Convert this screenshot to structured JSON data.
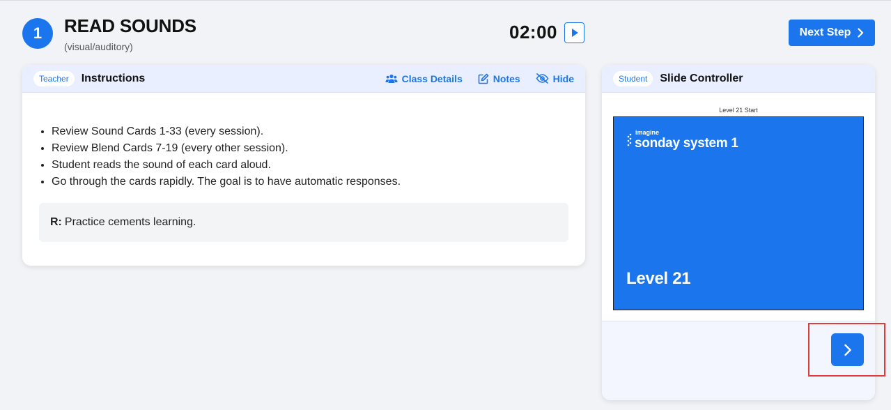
{
  "step": {
    "number": "1",
    "title": "READ SOUNDS",
    "subtitle": "(visual/auditory)"
  },
  "timer": {
    "time": "02:00",
    "play_icon": "play-icon"
  },
  "next_step": {
    "label": "Next Step",
    "icon": "chevron-right-icon"
  },
  "instructions_panel": {
    "badge": "Teacher",
    "title": "Instructions",
    "actions": [
      {
        "label": "Class Details",
        "icon": "users-icon"
      },
      {
        "label": "Notes",
        "icon": "edit-icon"
      },
      {
        "label": "Hide",
        "icon": "eye-off-icon"
      }
    ],
    "items": [
      "Review Sound Cards 1-33 (every session).",
      "Review Blend Cards 7-19 (every other session).",
      "Student reads the sound of each card aloud.",
      "Go through the cards rapidly. The goal is to have automatic responses."
    ],
    "reason_label": "R:",
    "reason_text": "Practice cements learning."
  },
  "slide_panel": {
    "badge": "Student",
    "title": "Slide Controller",
    "slide_caption": "Level 21 Start",
    "slide_brand_small": "imagine",
    "slide_brand": "sonday system 1",
    "slide_level": "Level 21",
    "next_icon": "chevron-right-icon"
  },
  "colors": {
    "accent": "#1b76ee",
    "background": "#f2f3f6",
    "panel_header": "#e9efff",
    "highlight": "#e33a3a"
  }
}
